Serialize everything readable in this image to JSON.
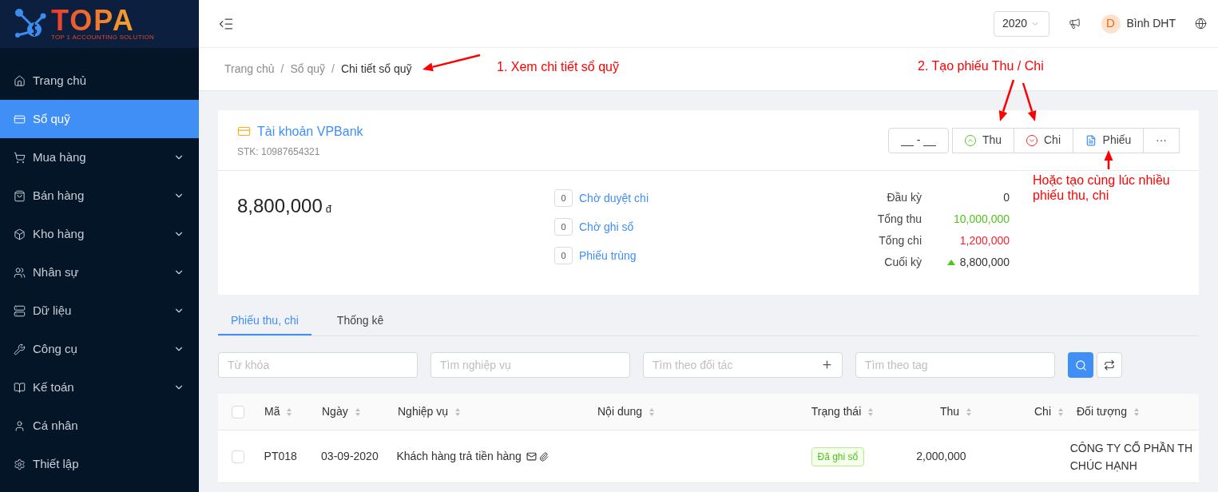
{
  "logo": {
    "name": "TOPA",
    "tagline": "TOP 1 ACCOUNTING SOLUTION"
  },
  "sidebar": {
    "items": [
      {
        "label": "Trang chủ",
        "selected": false,
        "expandable": false
      },
      {
        "label": "Sổ quỹ",
        "selected": true,
        "expandable": false
      },
      {
        "label": "Mua hàng",
        "selected": false,
        "expandable": true
      },
      {
        "label": "Bán hàng",
        "selected": false,
        "expandable": true
      },
      {
        "label": "Kho hàng",
        "selected": false,
        "expandable": true
      },
      {
        "label": "Nhân sự",
        "selected": false,
        "expandable": true
      },
      {
        "label": "Dữ liệu",
        "selected": false,
        "expandable": true
      },
      {
        "label": "Công cụ",
        "selected": false,
        "expandable": true
      },
      {
        "label": "Kế toán",
        "selected": false,
        "expandable": true
      },
      {
        "label": "Cá nhân",
        "selected": false,
        "expandable": false
      },
      {
        "label": "Thiết lập",
        "selected": false,
        "expandable": false
      }
    ]
  },
  "header": {
    "year": "2020",
    "user_initial": "D",
    "user_name": "Bình DHT"
  },
  "breadcrumb": {
    "separator": "/",
    "items": [
      "Trang chủ",
      "Sổ quỹ",
      "Chi tiết sổ quỹ"
    ]
  },
  "annotations": [
    {
      "text": "1. Xem chi tiết sổ quỹ"
    },
    {
      "text": "2. Tạo phiếu Thu / Chi"
    },
    {
      "text": "Hoặc tạo cùng lúc nhiều phiếu thu, chi"
    }
  ],
  "account": {
    "name": "Tài khoản VPBank",
    "number": "STK: 10987654321",
    "date_range": "__ - __",
    "actions": [
      {
        "label": "Thu",
        "kind": "in"
      },
      {
        "label": "Chi",
        "kind": "out"
      },
      {
        "label": "Phiếu",
        "kind": "doc"
      },
      {
        "label": "···",
        "kind": "more"
      }
    ],
    "balance": "8,800,000",
    "currency": "đ",
    "pending": [
      {
        "count": "0",
        "label": "Chờ duyệt chi"
      },
      {
        "count": "0",
        "label": "Chờ ghi sổ"
      },
      {
        "count": "0",
        "label": "Phiếu trùng"
      }
    ],
    "summary": [
      {
        "label": "Đầu kỳ",
        "value": "0",
        "kind": "plain"
      },
      {
        "label": "Tổng thu",
        "value": "10,000,000",
        "kind": "in"
      },
      {
        "label": "Tổng chi",
        "value": "1,200,000",
        "kind": "out"
      },
      {
        "label": "Cuối kỳ",
        "value": "8,800,000",
        "kind": "up"
      }
    ]
  },
  "tabs": [
    {
      "label": "Phiếu thu, chi",
      "selected": true
    },
    {
      "label": "Thống kê",
      "selected": false
    }
  ],
  "filters": [
    {
      "placeholder": "Từ khóa",
      "addable": false
    },
    {
      "placeholder": "Tìm nghiệp vụ",
      "addable": false
    },
    {
      "placeholder": "Tìm theo đối tác",
      "addable": true
    },
    {
      "placeholder": "Tìm theo tag",
      "addable": false
    }
  ],
  "table": {
    "all_checked": false,
    "columns": [
      "Mã",
      "Ngày",
      "Nghiệp vụ",
      "Nội dung",
      "Trạng thái",
      "Thu",
      "Chi",
      "Đối tượng"
    ],
    "rows": [
      {
        "checked": false,
        "code": "PT018",
        "date": "03-09-2020",
        "operation": "Khách hàng trả tiền hàng",
        "status": "Đã ghi sổ",
        "thu": "2,000,000",
        "party": [
          "CÔNG TY CỔ PHẦN TH",
          "CHÚC HẠNH"
        ]
      }
    ]
  }
}
